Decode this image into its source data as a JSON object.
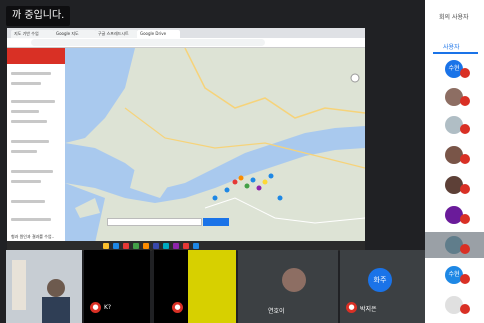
{
  "meeting": {
    "banner": "까 중입니다."
  },
  "shared_screen": {
    "tabs": [
      "지도 기반 수업",
      "Google 지도",
      "구글 스프레드시트",
      "Google Drive"
    ],
    "address": "",
    "left_panel_title": "",
    "left_panel_caption": "형과 원인과 결과를 수업..",
    "map_search": "",
    "map_button": ""
  },
  "tiles": [
    {
      "name": ""
    },
    {
      "name": "K?"
    },
    {
      "name": ""
    },
    {
      "name": ""
    },
    {
      "name": "연호이"
    },
    {
      "name": "박지은"
    }
  ],
  "center_avatar": {
    "text": "화주"
  },
  "side_panel": {
    "title": "회의 사용자",
    "tab": "사용자",
    "participants": [
      {
        "initials": "수현",
        "color": "#1a73e8"
      },
      {
        "initials": "",
        "color": "#8d6e63"
      },
      {
        "initials": "",
        "color": "#b0bec5"
      },
      {
        "initials": "",
        "color": "#795548"
      },
      {
        "initials": "",
        "color": "#5d4037"
      },
      {
        "initials": "",
        "color": "#6a1b9a"
      },
      {
        "initials": "",
        "color": "#607d8b"
      },
      {
        "initials": "수현",
        "color": "#1e88e5"
      },
      {
        "initials": "",
        "color": "#e0e0e0"
      }
    ]
  },
  "colors": {
    "mic_off": "#d93025",
    "accent": "#1a73e8"
  }
}
